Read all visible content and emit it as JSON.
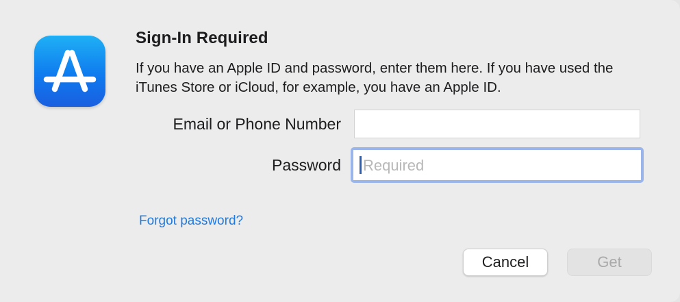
{
  "app": {
    "icon": "app-store-icon"
  },
  "dialog": {
    "title": "Sign-In Required",
    "description": "If you have an Apple ID and password, enter them here. If you have used the iTunes Store or iCloud, for example, you have an Apple ID."
  },
  "form": {
    "email_label": "Email or Phone Number",
    "email_value": "",
    "password_label": "Password",
    "password_placeholder": "Required"
  },
  "links": {
    "forgot_password": "Forgot password?"
  },
  "buttons": {
    "cancel_label": "Cancel",
    "get_label": "Get"
  },
  "colors": {
    "accent": "#1f7ae0",
    "focus_ring": "#9ab5ea",
    "icon_blue": "#0f7bef"
  }
}
